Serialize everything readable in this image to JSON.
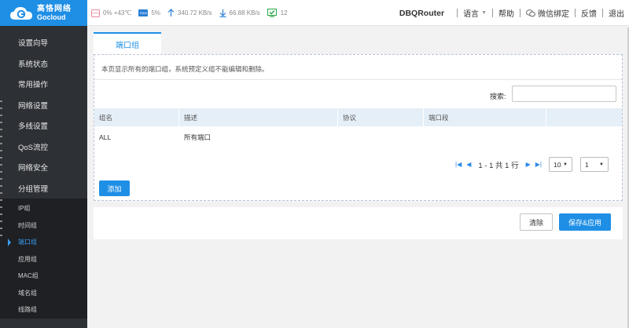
{
  "brand": {
    "name_cn": "高恪网络",
    "name_en": "Gocloud"
  },
  "status": {
    "cpu": "0%",
    "temp": "+43℃",
    "ram": "5%",
    "upload": "340.72 KB/s",
    "download": "66.88 KB/s",
    "online": "12"
  },
  "header": {
    "router_name": "DBQRouter",
    "language": "语言",
    "help": "帮助",
    "wechat": "微信绑定",
    "feedback": "反馈",
    "logout": "退出"
  },
  "sidebar": {
    "items": [
      {
        "label": "设置向导"
      },
      {
        "label": "系统状态"
      },
      {
        "label": "常用操作"
      },
      {
        "label": "网络设置"
      },
      {
        "label": "多线设置"
      },
      {
        "label": "QoS流控"
      },
      {
        "label": "网络安全"
      },
      {
        "label": "分组管理"
      }
    ],
    "sub_items": [
      {
        "label": "IP组"
      },
      {
        "label": "时间组"
      },
      {
        "label": "端口组"
      },
      {
        "label": "应用组"
      },
      {
        "label": "MAC组"
      },
      {
        "label": "域名组"
      },
      {
        "label": "线路组"
      }
    ]
  },
  "main": {
    "tab_label": "端口组",
    "description": "本页显示所有的端口组，系统预定义组不能编辑和删除。",
    "search_label": "搜索:",
    "search_value": "",
    "columns": [
      "组名",
      "描述",
      "协议",
      "端口段",
      ""
    ],
    "rows": [
      {
        "name": "ALL",
        "desc": "所有端口",
        "protocol": "",
        "ports": ""
      }
    ],
    "pagination": {
      "info": "1 - 1 共 1 行",
      "page_size": "10",
      "page": "1"
    },
    "add_label": "添加",
    "clear_label": "清除",
    "save_label": "保存&应用"
  }
}
